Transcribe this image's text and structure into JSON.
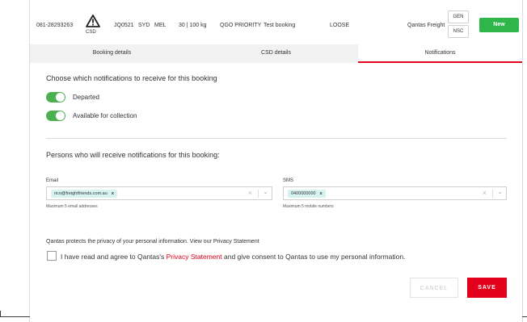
{
  "header": {
    "booking_number": "081-28293263",
    "csd_label": "CSD",
    "flight": "JQ0521",
    "origin": "SYD",
    "destination": "MEL",
    "weight": "30 | 100 kg",
    "service": "QGO PRIORITY",
    "booking_name": "Test booking",
    "pack_type": "LOOSE",
    "carrier": "Qantas Freight",
    "tags": [
      "GEN",
      "NSC"
    ],
    "status_label": "New"
  },
  "tabs": [
    {
      "label": "Booking details"
    },
    {
      "label": "CSD details"
    },
    {
      "label": "Notifications"
    }
  ],
  "notifications": {
    "heading": "Choose which notifications to receive for this booking",
    "toggles": [
      {
        "label": "Departed",
        "on": true
      },
      {
        "label": "Available for collection",
        "on": true
      }
    ]
  },
  "persons": {
    "heading": "Persons who will receive notifications for this booking:",
    "email": {
      "label": "Email",
      "chip": "rico@freightfriends.com.au",
      "hint": "Maximum 5 email addresses"
    },
    "sms": {
      "label": "SMS",
      "chip": "0400000000",
      "hint": "Maximum 5 mobile numbers"
    }
  },
  "privacy": {
    "notice": "Qantas protects the privacy of your personal information. View our Privacy Statement",
    "agree_prefix": "I have read and agree to Qantas's ",
    "agree_link": "Privacy Statement",
    "agree_suffix": " and give consent to Qantas to use my personal information."
  },
  "actions": {
    "cancel": "CANCEL",
    "save": "SAVE"
  },
  "colors": {
    "accent_red": "#e3001b",
    "toggle_green": "#4caf50",
    "new_green": "#2fb64b"
  }
}
